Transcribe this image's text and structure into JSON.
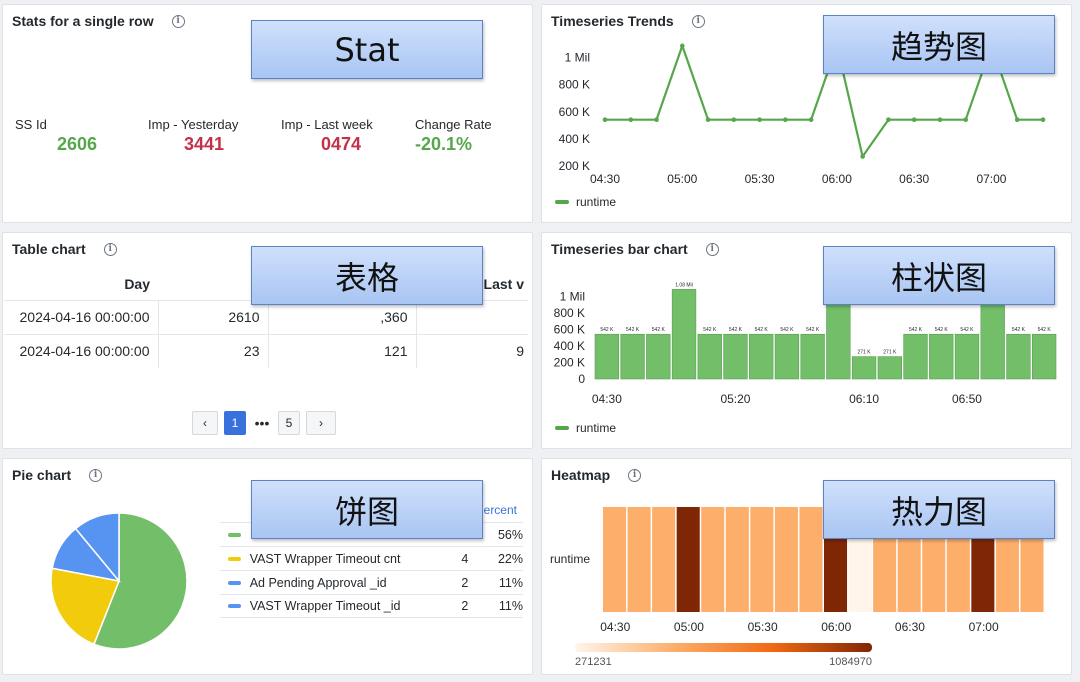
{
  "stat_panel": {
    "title": "Stats for a single row",
    "overlay": "Stat",
    "stats": [
      {
        "label": "SS Id",
        "value": "2606",
        "color": "#56a64b"
      },
      {
        "label": "Imp - Yesterday",
        "value": "3441",
        "color": "#c4314b"
      },
      {
        "label": "Imp - Last week",
        "value": "0474",
        "color": "#c4314b"
      },
      {
        "label": "Change Rate",
        "value": "-20.1%",
        "color": "#56a64b"
      }
    ]
  },
  "trends_panel": {
    "title": "Timeseries Trends",
    "overlay": "趋势图",
    "legend": "runtime",
    "color": "#56a64b"
  },
  "table_panel": {
    "title": "Table chart",
    "overlay": "表格",
    "headers": [
      "Day",
      "I",
      "",
      "Last v"
    ],
    "rows": [
      [
        "2024-04-16 00:00:00",
        "2610",
        ",360",
        ""
      ],
      [
        "2024-04-16 00:00:00",
        "23",
        "121",
        "9"
      ]
    ],
    "pagination": {
      "prev": "‹",
      "current": "1",
      "ellipsis": "•••",
      "last": "5",
      "next": "›"
    }
  },
  "bar_panel": {
    "title": "Timeseries bar chart",
    "overlay": "柱状图",
    "legend": "runtime",
    "color": "#73bf69"
  },
  "pie_panel": {
    "title": "Pie chart",
    "overlay": "饼图",
    "legend_header": "ercent",
    "legend": [
      {
        "name": "",
        "value": "",
        "percent": "56%",
        "color": "#73bf69"
      },
      {
        "name": "VAST Wrapper Timeout cnt",
        "value": "4",
        "percent": "22%",
        "color": "#f2cc0c"
      },
      {
        "name": "Ad Pending Approval _id",
        "value": "2",
        "percent": "11%",
        "color": "#5794f2"
      },
      {
        "name": "VAST Wrapper Timeout _id",
        "value": "2",
        "percent": "11%",
        "color": "#5794f2"
      }
    ]
  },
  "heatmap_panel": {
    "title": "Heatmap",
    "overlay": "热力图",
    "y_label": "runtime",
    "scale_min": "271231",
    "scale_max": "1084970"
  },
  "chart_data": [
    {
      "type": "line",
      "title": "Timeseries Trends",
      "x": [
        "04:30",
        "04:40",
        "04:50",
        "05:00",
        "05:10",
        "05:20",
        "05:30",
        "05:40",
        "05:50",
        "06:00",
        "06:10",
        "06:20",
        "06:30",
        "06:40",
        "06:50",
        "07:00",
        "07:10",
        "07:20"
      ],
      "series": [
        {
          "name": "runtime",
          "values": [
            542000,
            542000,
            542000,
            1085000,
            542000,
            542000,
            542000,
            542000,
            542000,
            1085000,
            271000,
            542000,
            542000,
            542000,
            542000,
            1085000,
            542000,
            542000
          ]
        }
      ],
      "x_ticks": [
        "04:30",
        "05:00",
        "05:30",
        "06:00",
        "06:30",
        "07:00"
      ],
      "y_ticks": [
        "200 K",
        "400 K",
        "600 K",
        "800 K",
        "1 Mil"
      ],
      "ylim": [
        150000,
        1150000
      ]
    },
    {
      "type": "bar",
      "title": "Timeseries bar chart",
      "x": [
        "04:30",
        "04:40",
        "04:50",
        "05:00",
        "05:10",
        "05:20",
        "05:30",
        "05:40",
        "05:50",
        "06:00",
        "06:10",
        "06:20",
        "06:30",
        "06:40",
        "06:50",
        "07:00",
        "07:10",
        "07:20"
      ],
      "series": [
        {
          "name": "runtime",
          "values": [
            542000,
            542000,
            542000,
            1085000,
            542000,
            542000,
            542000,
            542000,
            542000,
            1085000,
            271000,
            271000,
            542000,
            542000,
            542000,
            1085000,
            542000,
            542000
          ]
        }
      ],
      "data_labels": [
        "542 K",
        "542 K",
        "542 K",
        "1.08 Mil",
        "542 K",
        "542 K",
        "542 K",
        "542 K",
        "542 K",
        "1.08 Mil",
        "271 K",
        "271 K",
        "542 K",
        "542 K",
        "542 K",
        "1.08 Mil",
        "542 K",
        "542 K"
      ],
      "x_ticks": [
        "04:30",
        "05:20",
        "06:10",
        "06:50"
      ],
      "y_ticks": [
        "0",
        "200 K",
        "400 K",
        "600 K",
        "800 K",
        "1 Mil"
      ],
      "ylim": [
        0,
        1150000
      ]
    },
    {
      "type": "pie",
      "title": "Pie chart",
      "slices": [
        {
          "label": "",
          "value": 56,
          "color": "#73bf69"
        },
        {
          "label": "VAST Wrapper Timeout cnt",
          "value": 22,
          "color": "#f2cc0c"
        },
        {
          "label": "Ad Pending Approval _id",
          "value": 11,
          "color": "#5794f2"
        },
        {
          "label": "VAST Wrapper Timeout _id",
          "value": 11,
          "color": "#5794f2"
        }
      ]
    },
    {
      "type": "heatmap",
      "title": "Heatmap",
      "x": [
        "04:30",
        "04:40",
        "04:50",
        "05:00",
        "05:10",
        "05:20",
        "05:30",
        "05:40",
        "05:50",
        "06:00",
        "06:10",
        "06:20",
        "06:30",
        "06:40",
        "06:50",
        "07:00",
        "07:10",
        "07:20"
      ],
      "y": [
        "runtime"
      ],
      "values": [
        542000,
        542000,
        542000,
        1085000,
        542000,
        542000,
        542000,
        542000,
        542000,
        1085000,
        271000,
        542000,
        542000,
        542000,
        542000,
        1085000,
        542000,
        542000
      ],
      "x_ticks": [
        "04:30",
        "05:00",
        "05:30",
        "06:00",
        "06:30",
        "07:00"
      ],
      "range": [
        271231,
        1084970
      ]
    }
  ]
}
